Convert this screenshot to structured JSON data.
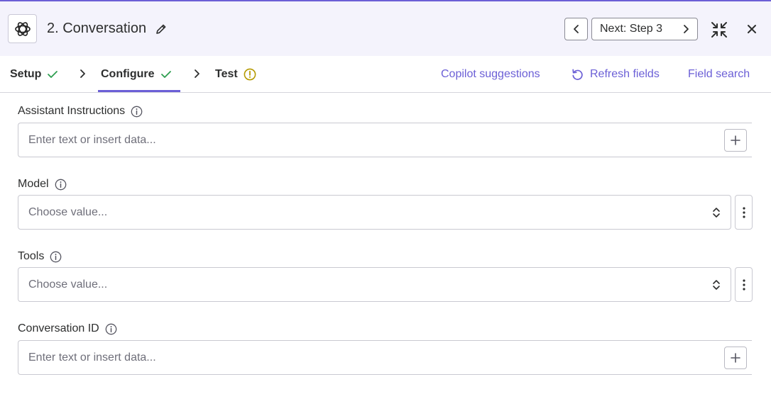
{
  "header": {
    "step_title": "2. Conversation",
    "next_button_label": "Next: Step 3"
  },
  "tabs": [
    {
      "label": "Setup",
      "status": "complete"
    },
    {
      "label": "Configure",
      "status": "complete",
      "active": true
    },
    {
      "label": "Test",
      "status": "warning"
    }
  ],
  "toolbar_links": {
    "copilot": "Copilot suggestions",
    "refresh": "Refresh fields",
    "field_search": "Field search"
  },
  "fields": [
    {
      "label": "Assistant Instructions",
      "type": "text",
      "placeholder": "Enter text or insert data..."
    },
    {
      "label": "Model",
      "type": "select",
      "placeholder": "Choose value..."
    },
    {
      "label": "Tools",
      "type": "select",
      "placeholder": "Choose value..."
    },
    {
      "label": "Conversation ID",
      "type": "text",
      "placeholder": "Enter text or insert data..."
    }
  ],
  "colors": {
    "accent": "#6b5fd6",
    "success": "#2e9e4f",
    "warning": "#b59a00",
    "header_bg": "#f4f3fc"
  },
  "icons": {
    "app_logo": "openai-logo-icon",
    "edit": "pencil-icon",
    "prev": "chevron-left-icon",
    "next": "chevron-right-icon",
    "collapse": "collapse-arrows-icon",
    "close": "close-icon",
    "refresh": "refresh-icon",
    "info": "info-icon",
    "add": "plus-icon",
    "select": "chevron-up-down-icon",
    "more": "vertical-dots-icon"
  }
}
